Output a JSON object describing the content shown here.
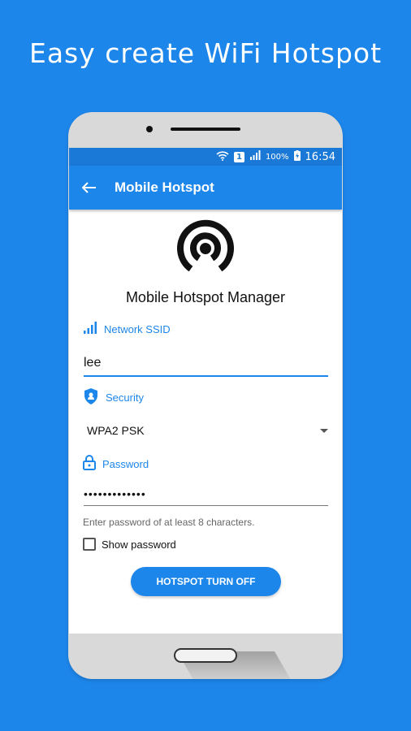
{
  "headline": "Easy create WiFi Hotspot",
  "status_bar": {
    "sim": "1",
    "battery": "100%",
    "time": "16:54",
    "icons": [
      "wifi-hotspot-icon",
      "sim-icon",
      "signal-icon",
      "battery-charging-icon"
    ]
  },
  "app_bar": {
    "back_icon": "back-arrow-icon",
    "title": "Mobile Hotspot"
  },
  "app": {
    "logo_icon": "hotspot-icon",
    "name": "Mobile Hotspot Manager"
  },
  "form": {
    "ssid": {
      "label": "Network SSID",
      "icon": "signal-icon",
      "value": "lee"
    },
    "security": {
      "label": "Security",
      "icon": "shield-icon",
      "value": "WPA2 PSK"
    },
    "password": {
      "label": "Password",
      "icon": "lock-icon",
      "value": "•••••••••••••",
      "hint": "Enter password of at least 8 characters."
    },
    "show_password": {
      "label": "Show password",
      "checked": false
    },
    "toggle_button": "HOTSPOT TURN OFF"
  },
  "colors": {
    "background": "#1d86ea",
    "accent": "#1d86ea",
    "status_bar": "#1a78d6"
  }
}
